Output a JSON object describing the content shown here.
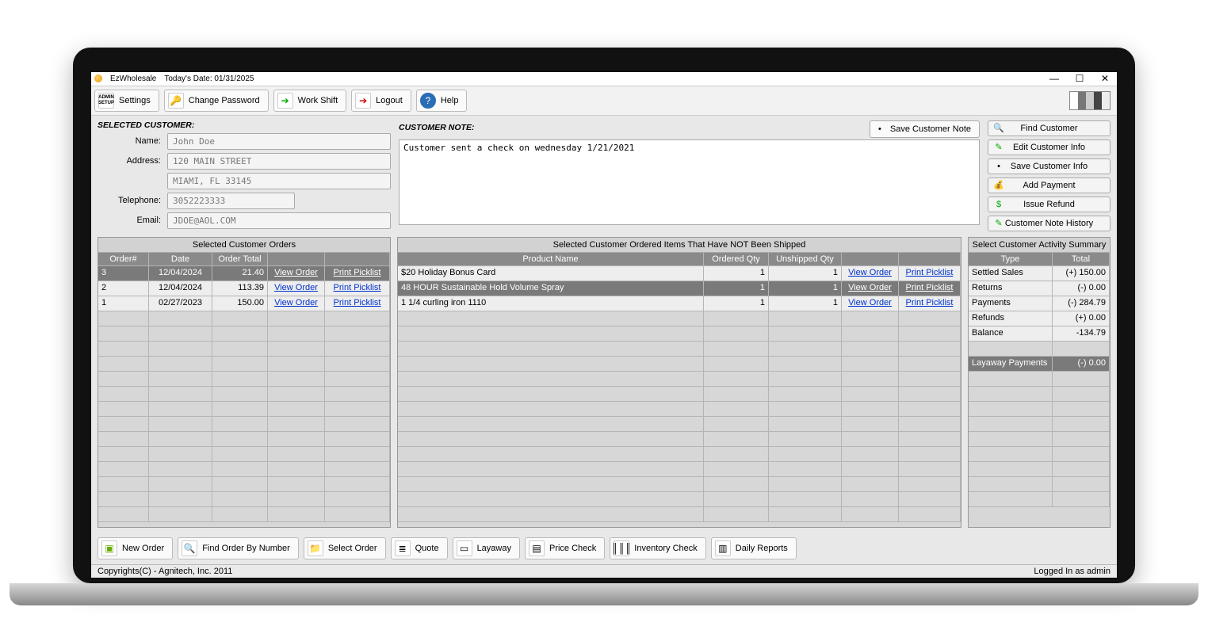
{
  "titlebar": {
    "app": "EzWholesale",
    "date_label": "Today's Date: 01/31/2025"
  },
  "toolbar": {
    "settings": "Settings",
    "change_password": "Change Password",
    "work_shift": "Work Shift",
    "logout": "Logout",
    "help": "Help"
  },
  "labels": {
    "selected_customer": "SELECTED CUSTOMER:",
    "name": "Name:",
    "address": "Address:",
    "telephone": "Telephone:",
    "email": "Email:",
    "customer_note": "CUSTOMER NOTE:",
    "save_note": "Save Customer Note"
  },
  "customer": {
    "name": "John Doe",
    "addr1": "120 MAIN STREET",
    "addr2": "MIAMI, FL 33145",
    "phone": "3052223333",
    "email": "JDOE@AOL.COM"
  },
  "note": "Customer sent a check on wednesday 1/21/2021",
  "actions": {
    "find_customer": "Find Customer",
    "edit_customer": "Edit Customer Info",
    "save_customer": "Save Customer Info",
    "add_payment": "Add Payment",
    "issue_refund": "Issue Refund",
    "note_history": "Customer Note History"
  },
  "orders_panel": {
    "title": "Selected Customer Orders",
    "cols": [
      "Order#",
      "Date",
      "Order Total",
      "",
      ""
    ],
    "view": "View Order",
    "print": "Print Picklist",
    "rows": [
      {
        "num": "3",
        "date": "12/04/2024",
        "total": "21.40",
        "sel": true
      },
      {
        "num": "2",
        "date": "12/04/2024",
        "total": "113.39",
        "sel": false
      },
      {
        "num": "1",
        "date": "02/27/2023",
        "total": "150.00",
        "sel": false
      }
    ]
  },
  "unshipped_panel": {
    "title": "Selected Customer Ordered Items That Have NOT Been Shipped",
    "cols": [
      "Product Name",
      "Ordered Qty",
      "Unshipped Qty",
      "",
      ""
    ],
    "view": "View Order",
    "print": "Print Picklist",
    "rows": [
      {
        "name": "$20 Holiday Bonus Card",
        "oq": "1",
        "uq": "1",
        "sel": false
      },
      {
        "name": "48 HOUR Sustainable Hold Volume Spray",
        "oq": "1",
        "uq": "1",
        "sel": true
      },
      {
        "name": "1 1/4 curling iron 1110",
        "oq": "1",
        "uq": "1",
        "sel": false
      }
    ]
  },
  "summary_panel": {
    "title": "Select Customer Activity Summary",
    "cols": [
      "Type",
      "Total"
    ],
    "rows": [
      {
        "t": "Settled Sales",
        "v": "(+) 150.00"
      },
      {
        "t": "Returns",
        "v": "(-) 0.00"
      },
      {
        "t": "Payments",
        "v": "(-) 284.79"
      },
      {
        "t": "Refunds",
        "v": "(+) 0.00"
      },
      {
        "t": "Balance",
        "v": "-134.79"
      }
    ],
    "layaway": {
      "t": "Layaway Payments",
      "v": "(-) 0.00"
    }
  },
  "bottom": {
    "new_order": "New Order",
    "find_order": "Find Order By Number",
    "select_order": "Select Order",
    "quote": "Quote",
    "layaway": "Layaway",
    "price_check": "Price Check",
    "inventory_check": "Inventory Check",
    "daily_reports": "Daily Reports"
  },
  "status": {
    "copyright": "Copyrights(C) - Agnitech, Inc. 2011",
    "login": "Logged In as admin"
  }
}
